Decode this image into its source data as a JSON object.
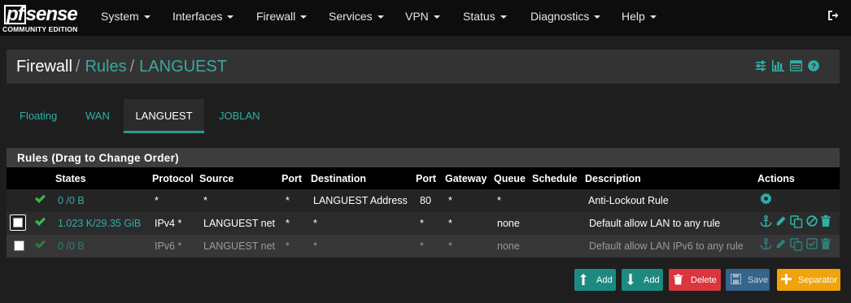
{
  "logo": {
    "brand": "pfsense",
    "edition": "COMMUNITY EDITION"
  },
  "nav": {
    "items": [
      {
        "label": "System"
      },
      {
        "label": "Interfaces"
      },
      {
        "label": "Firewall"
      },
      {
        "label": "Services"
      },
      {
        "label": "VPN"
      },
      {
        "label": "Status"
      },
      {
        "label": "Diagnostics"
      },
      {
        "label": "Help"
      }
    ],
    "logout_icon": "sign-out-icon"
  },
  "breadcrumb": {
    "part1": "Firewall",
    "sep": "/",
    "part2": "Rules",
    "part3": "LANGUEST",
    "icons": [
      "sliders-icon",
      "bar-chart-icon",
      "table-icon",
      "question-circle-icon"
    ]
  },
  "tabs": {
    "items": [
      {
        "label": "Floating"
      },
      {
        "label": "WAN"
      },
      {
        "label": "LANGUEST"
      },
      {
        "label": "JOBLAN"
      }
    ],
    "active": "LANGUEST"
  },
  "panel": {
    "title": "Rules (Drag to Change Order)",
    "columns": {
      "states": "States",
      "protocol": "Protocol",
      "source": "Source",
      "port": "Port",
      "destination": "Destination",
      "dport": "Port",
      "gateway": "Gateway",
      "queue": "Queue",
      "schedule": "Schedule",
      "description": "Description",
      "actions": "Actions"
    },
    "rows": [
      {
        "states": "0 /0 B",
        "protocol": "*",
        "source": "*",
        "port": "*",
        "destination": "LANGUEST Address",
        "dport": "80",
        "gateway": "*",
        "queue": "*",
        "schedule": "",
        "description": "Anti-Lockout Rule",
        "enabled": true
      },
      {
        "states": "1.023 K/29.35 GiB",
        "protocol": "IPv4 *",
        "source": "LANGUEST net",
        "port": "*",
        "destination": "*",
        "dport": "*",
        "gateway": "*",
        "queue": "none",
        "schedule": "",
        "description": "Default allow LAN to any rule",
        "enabled": true
      },
      {
        "states": "0 /0 B",
        "protocol": "IPv6 *",
        "source": "LANGUEST net",
        "port": "*",
        "destination": "*",
        "dport": "*",
        "gateway": "*",
        "queue": "none",
        "schedule": "",
        "description": "Default allow LAN IPv6 to any rule",
        "enabled": false
      }
    ]
  },
  "buttons": {
    "add_top": "Add",
    "add_bottom": "Add",
    "delete": "Delete",
    "save": "Save",
    "separator": "Separator"
  },
  "colors": {
    "accent": "#2a9a92",
    "green": "#39b54a",
    "delete": "#d9363e",
    "save": "#36648b",
    "separator": "#f0a30a"
  }
}
